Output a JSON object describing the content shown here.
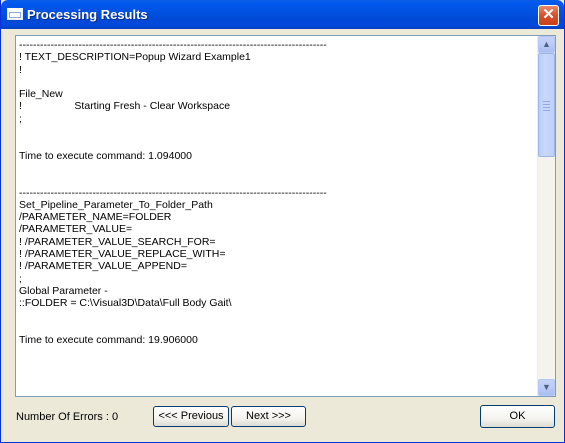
{
  "window": {
    "title": "Processing Results",
    "close_glyph": "✕"
  },
  "log": {
    "text": "----------------------------------------------------------------------------------------\n! TEXT_DESCRIPTION=Popup Wizard Example1\n!\n\nFile_New\n!                  Starting Fresh - Clear Workspace\n;\n\n\nTime to execute command: 1.094000\n\n\n----------------------------------------------------------------------------------------\nSet_Pipeline_Parameter_To_Folder_Path\n/PARAMETER_NAME=FOLDER\n/PARAMETER_VALUE=\n! /PARAMETER_VALUE_SEARCH_FOR=\n! /PARAMETER_VALUE_REPLACE_WITH=\n! /PARAMETER_VALUE_APPEND=\n;\nGlobal Parameter -\n::FOLDER = C:\\Visual3D\\Data\\Full Body Gait\\\n\n\nTime to execute command: 19.906000\n\n\n"
  },
  "scrollbar": {
    "up_glyph": "▲",
    "down_glyph": "▼"
  },
  "footer": {
    "errors_label": "Number Of Errors :",
    "errors_count": "0",
    "previous_label": "<<< Previous",
    "next_label": "Next >>>",
    "ok_label": "OK"
  },
  "icons": {
    "title": "window-icon",
    "close": "close-icon",
    "scroll_up": "scroll-up-arrow-icon",
    "scroll_down": "scroll-down-arrow-icon"
  },
  "colors": {
    "title_bar": "#0058ee",
    "close_button": "#d8542e",
    "dialog_background": "#ece9d8",
    "text_area_background": "#ffffff",
    "text_area_border": "#7f9db9",
    "button_border": "#003c74"
  }
}
